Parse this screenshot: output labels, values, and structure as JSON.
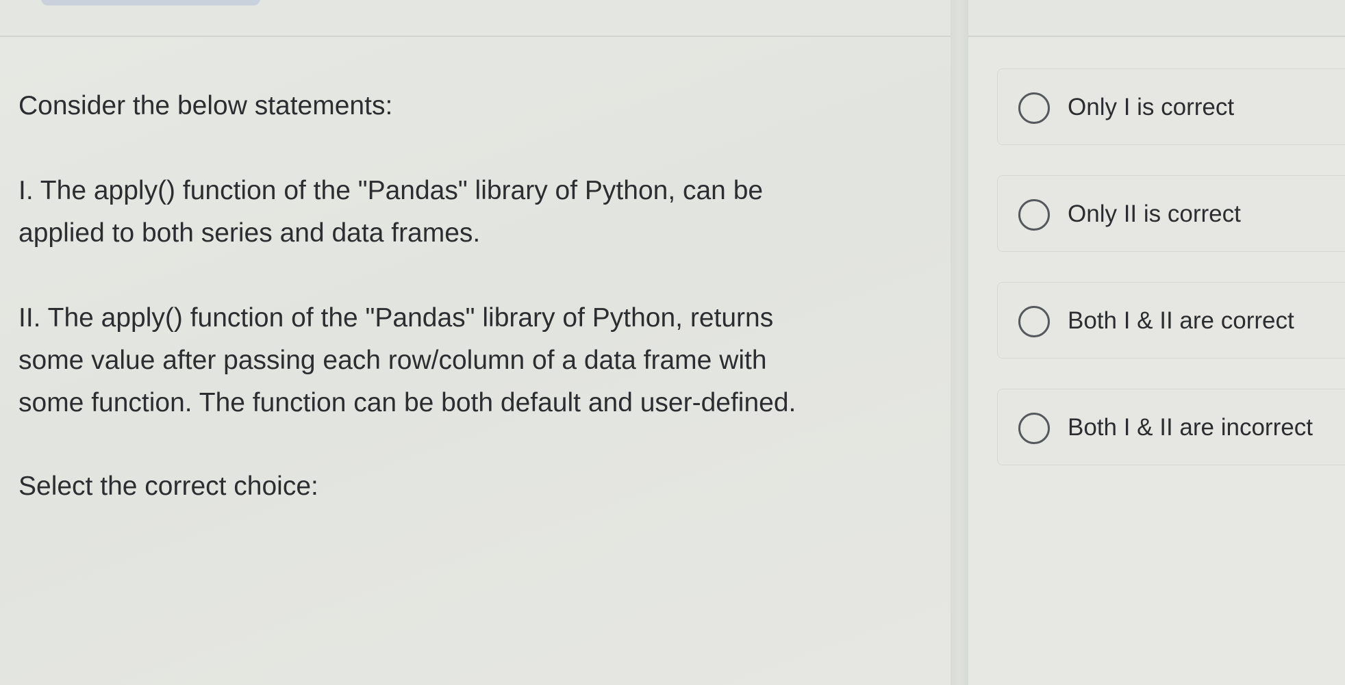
{
  "question": {
    "intro": "Consider the below statements:",
    "statement_1": {
      "line_1": "I. The apply() function of the \"Pandas\" library of Python, can be",
      "line_2": "applied to both series and data frames."
    },
    "statement_2": {
      "line_1": "II. The apply() function of the \"Pandas\" library of Python, returns",
      "line_2": "some value after passing each row/column of a data frame with",
      "line_3": "some function. The function can be both default and user-defined."
    },
    "prompt": "Select the correct choice:"
  },
  "options": [
    {
      "label": "Only I is correct",
      "selected": false
    },
    {
      "label": "Only II is correct",
      "selected": false
    },
    {
      "label": "Both I & II are correct",
      "selected": false
    },
    {
      "label": "Both I & II are incorrect",
      "selected": false
    }
  ],
  "colors": {
    "background": "#e4e6e1",
    "text": "#2b2d30",
    "radio_border": "#55585c"
  }
}
